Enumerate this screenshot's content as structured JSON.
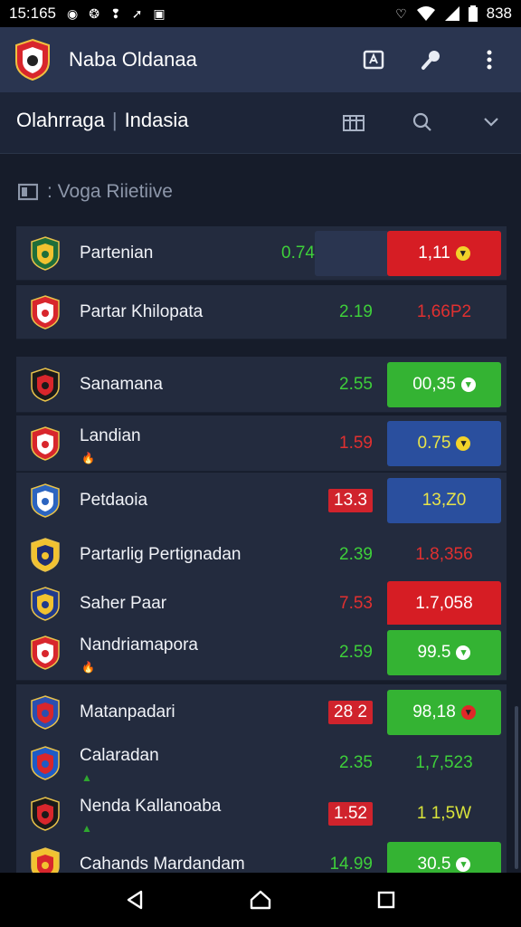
{
  "status_bar": {
    "time": "15:165",
    "right_text": "838",
    "icons": [
      "whatsapp-icon",
      "app-icon",
      "notification-icon",
      "cast-icon",
      "heart-icon",
      "wifi-icon",
      "signal-icon",
      "battery-icon"
    ]
  },
  "app_bar": {
    "title": "Naba Oldanaa",
    "actions": [
      "share-icon",
      "tool-icon",
      "more-vertical-icon"
    ]
  },
  "tabs": {
    "left": "Olahrraga",
    "separator": "|",
    "right": "Indasia",
    "icons": [
      "calendar-icon",
      "search-icon",
      "chevron-down-icon"
    ]
  },
  "section": {
    "title": ": Voga Riietiive"
  },
  "matches": [
    {
      "name": "Partenian",
      "odd1": "0.74",
      "odd1_style": "green",
      "odd2": "1,11",
      "odd2_bg": "#d61d24",
      "odd2_color": "#ffffff",
      "odd2_mark": "yellow"
    },
    {
      "name": "Partar Khilopata",
      "odd1": "2.19",
      "odd1_style": "green",
      "odd2": "1,66P2",
      "odd2_bg": "transparent",
      "odd2_color": "#e03030",
      "odd2_mark": ""
    },
    {
      "name": "Sanamana",
      "odd1": "2.55",
      "odd1_style": "green",
      "odd2": "00,35",
      "odd2_bg": "#34b333",
      "odd2_color": "#ffffff",
      "odd2_mark": "white"
    },
    {
      "name": "Landian",
      "odd1": "1.59",
      "odd1_style": "red",
      "odd2": "0.75",
      "odd2_bg": "#2a4f9e",
      "odd2_color": "#e8e44a",
      "odd2_mark": "yellow"
    },
    {
      "name": "Petdaoia",
      "odd1": "13.3",
      "odd1_style": "pill",
      "odd2": "13,Z0",
      "odd2_bg": "#2a4f9e",
      "odd2_color": "#e8e44a",
      "odd2_mark": ""
    },
    {
      "name": "Partarlig Pertignadan",
      "odd1": "2.39",
      "odd1_style": "green",
      "odd2": "1.8,356",
      "odd2_bg": "transparent",
      "odd2_color": "#e03030",
      "odd2_mark": ""
    },
    {
      "name": "Saher Paar",
      "odd1": "7.53",
      "odd1_style": "red",
      "odd2": "1.7,058",
      "odd2_bg": "#d61d24",
      "odd2_color": "#ffffff",
      "odd2_mark": ""
    },
    {
      "name": "Nandriamapora",
      "odd1": "2.59",
      "odd1_style": "green",
      "odd2": "99.5",
      "odd2_bg": "#34b333",
      "odd2_color": "#ffffff",
      "odd2_mark": "white"
    },
    {
      "name": "Matanpadari",
      "odd1": "28 2",
      "odd1_style": "pill",
      "odd2": "98,18",
      "odd2_bg": "#34b333",
      "odd2_color": "#ffffff",
      "odd2_mark": "red"
    },
    {
      "name": "Calaradan",
      "odd1": "2.35",
      "odd1_style": "green",
      "odd2": "1,7,523",
      "odd2_bg": "transparent",
      "odd2_color": "#3ecf3a",
      "odd2_mark": ""
    },
    {
      "name": "Nenda Kallanoaba",
      "odd1": "1.52",
      "odd1_style": "pill",
      "odd2": "1 1,5W",
      "odd2_bg": "transparent",
      "odd2_color": "#d9e43a",
      "odd2_mark": ""
    },
    {
      "name": "Cahands Mardandam",
      "odd1": "14.99",
      "odd1_style": "green",
      "odd2": "30.5",
      "odd2_bg": "#34b333",
      "odd2_color": "#ffffff",
      "odd2_mark": "white"
    }
  ],
  "nav_bar": [
    "back-icon",
    "home-icon",
    "recents-icon"
  ]
}
